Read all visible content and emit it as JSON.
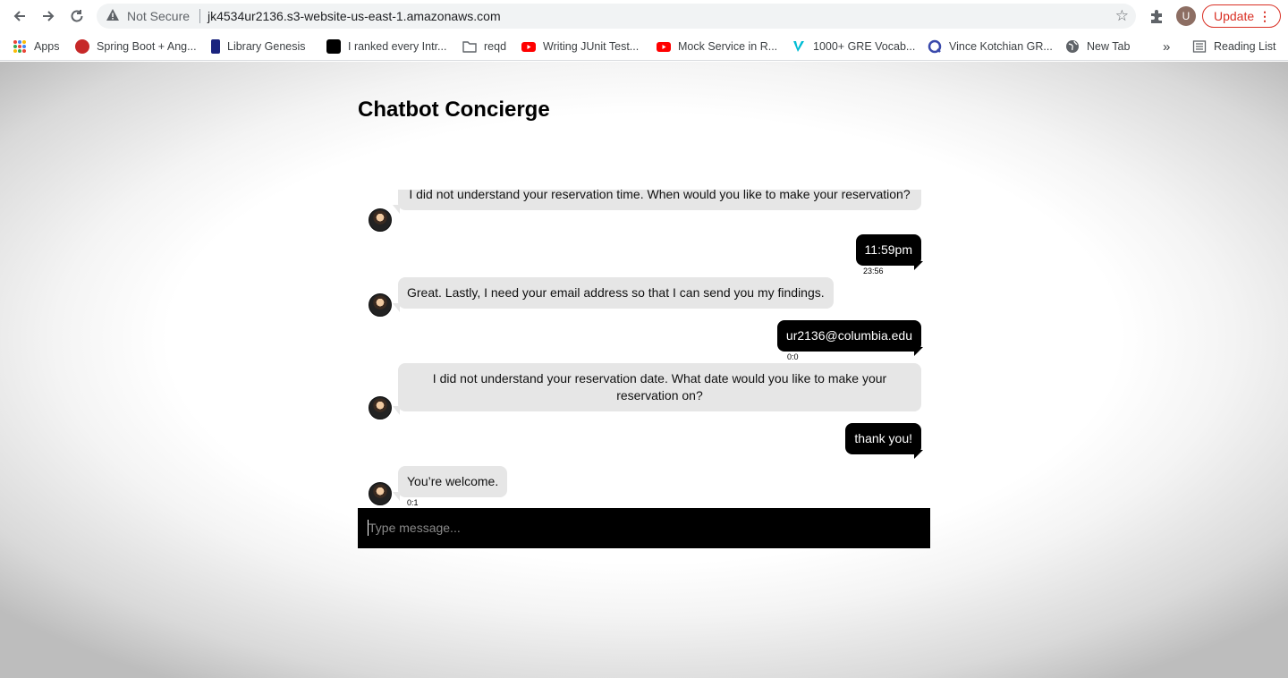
{
  "browser": {
    "security_label": "Not Secure",
    "url": "jk4534ur2136.s3-website-us-east-1.amazonaws.com",
    "profile_initial": "U",
    "update_label": "Update",
    "overflow_label": "»",
    "reading_list_label": "Reading List",
    "bookmarks": [
      {
        "label": "Apps",
        "icon": "apps-grid-icon"
      },
      {
        "label": "Spring Boot + Ang...",
        "icon": "site-icon",
        "color": "#c62828"
      },
      {
        "label": "Library Genesis",
        "icon": "site-icon",
        "color": "#1a237e"
      },
      {
        "label": "I ranked every Intr...",
        "icon": "site-icon",
        "color": "#000000"
      },
      {
        "label": "reqd",
        "icon": "folder-icon"
      },
      {
        "label": "Writing JUnit Test...",
        "icon": "youtube-icon",
        "color": "#ff0000"
      },
      {
        "label": "Mock Service in R...",
        "icon": "youtube-icon",
        "color": "#ff0000"
      },
      {
        "label": "1000+ GRE Vocab...",
        "icon": "site-icon",
        "color": "#00bcd4"
      },
      {
        "label": "Vince Kotchian GR...",
        "icon": "site-icon",
        "color": "#3949ab"
      },
      {
        "label": "New Tab",
        "icon": "globe-icon"
      }
    ]
  },
  "page": {
    "title": "Chatbot Concierge"
  },
  "chat": {
    "messages": [
      {
        "from": "bot",
        "text": "I did not understand your reservation time. When would you like to make your reservation?"
      },
      {
        "from": "user",
        "text": "11:59pm",
        "time": "23:56"
      },
      {
        "from": "bot",
        "text": "Great. Lastly, I need your email address so that I can send you my findings."
      },
      {
        "from": "user",
        "text": "ur2136@columbia.edu",
        "time": "0:0"
      },
      {
        "from": "bot",
        "text": "I did not understand your reservation date. What date would you like to make your reservation on?"
      },
      {
        "from": "user",
        "text": "thank you!"
      },
      {
        "from": "bot",
        "text": "You’re welcome.",
        "time": "0:1"
      }
    ],
    "input_placeholder": "Type message..."
  }
}
